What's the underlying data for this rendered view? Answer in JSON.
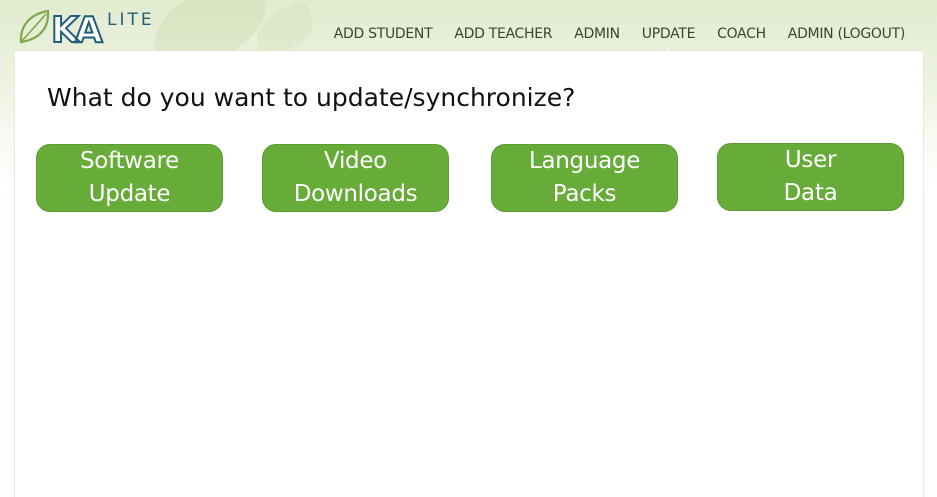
{
  "logo": {
    "text_ka": "KA",
    "text_lite": "LITE",
    "icon": "leaf-icon",
    "colors": {
      "leaf": "#7fa84a",
      "ka": "#1f5f7a",
      "lite": "#1f5f7a"
    }
  },
  "nav": {
    "items": [
      {
        "label": "ADD STUDENT"
      },
      {
        "label": "ADD TEACHER"
      },
      {
        "label": "ADMIN"
      },
      {
        "label": "UPDATE",
        "active": true
      },
      {
        "label": "COACH"
      },
      {
        "label": "ADMIN (LOGOUT)"
      }
    ]
  },
  "main": {
    "title": "What do you want to update/synchronize?",
    "buttons": [
      {
        "line1": "Software",
        "line2": "Update"
      },
      {
        "line1": "Video",
        "line2": "Downloads"
      },
      {
        "line1": "Language",
        "line2": "Packs"
      },
      {
        "line1": "User",
        "line2": "Data"
      }
    ]
  },
  "colors": {
    "button_green": "#67ab38",
    "nav_text": "#3b4626",
    "header_bg": "#e2ebcf"
  }
}
